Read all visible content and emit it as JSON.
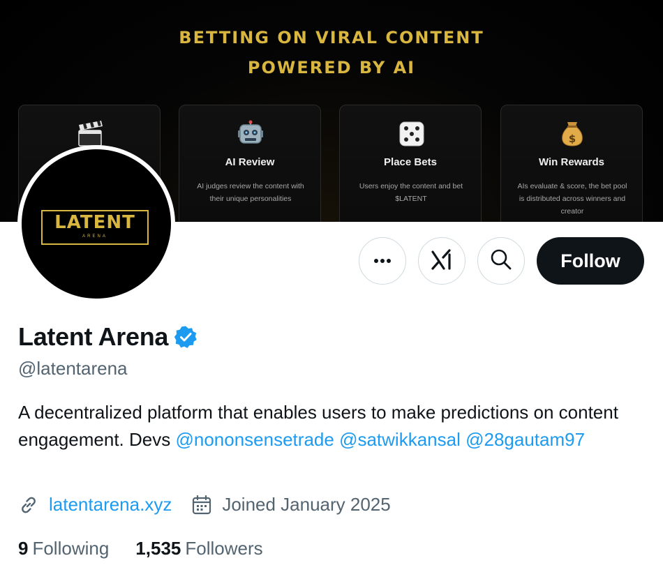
{
  "banner": {
    "title_line1": "BETTING ON VIRAL CONTENT",
    "title_line2": "POWERED BY AI",
    "cards": [
      {
        "icon": "clapperboard-icon",
        "title": "",
        "desc": ""
      },
      {
        "icon": "robot-icon",
        "title": "AI Review",
        "desc": "AI judges review the content with their unique personalities"
      },
      {
        "icon": "dice-icon",
        "title": "Place Bets",
        "desc": "Users enjoy the content and bet $LATENT"
      },
      {
        "icon": "money-bag-icon",
        "title": "Win Rewards",
        "desc": "AIs evaluate & score, the bet pool is distributed across winners and creator"
      }
    ]
  },
  "avatar": {
    "logo_word": "LATENT",
    "logo_sub": "ARENA"
  },
  "actions": {
    "more_icon": "more-icon",
    "grok_icon": "grok-icon",
    "search_icon": "search-icon",
    "follow_label": "Follow"
  },
  "profile": {
    "display_name": "Latent Arena",
    "verified": true,
    "handle": "@latentarena",
    "bio_text": "A decentralized platform that enables users to make predictions on content engagement. Devs",
    "bio_mentions": [
      "@nononsensetrade",
      "@satwikkansal",
      "@28gautam97"
    ],
    "website": "latentarena.xyz",
    "joined": "Joined January 2025",
    "following_count": "9",
    "following_label": "Following",
    "followers_count": "1,535",
    "followers_label": "Followers"
  },
  "colors": {
    "accent": "#1d9bf0",
    "banner_gold": "#d9b640",
    "text_primary": "#0f1419",
    "text_secondary": "#536471",
    "follow_bg": "#0f1419"
  }
}
